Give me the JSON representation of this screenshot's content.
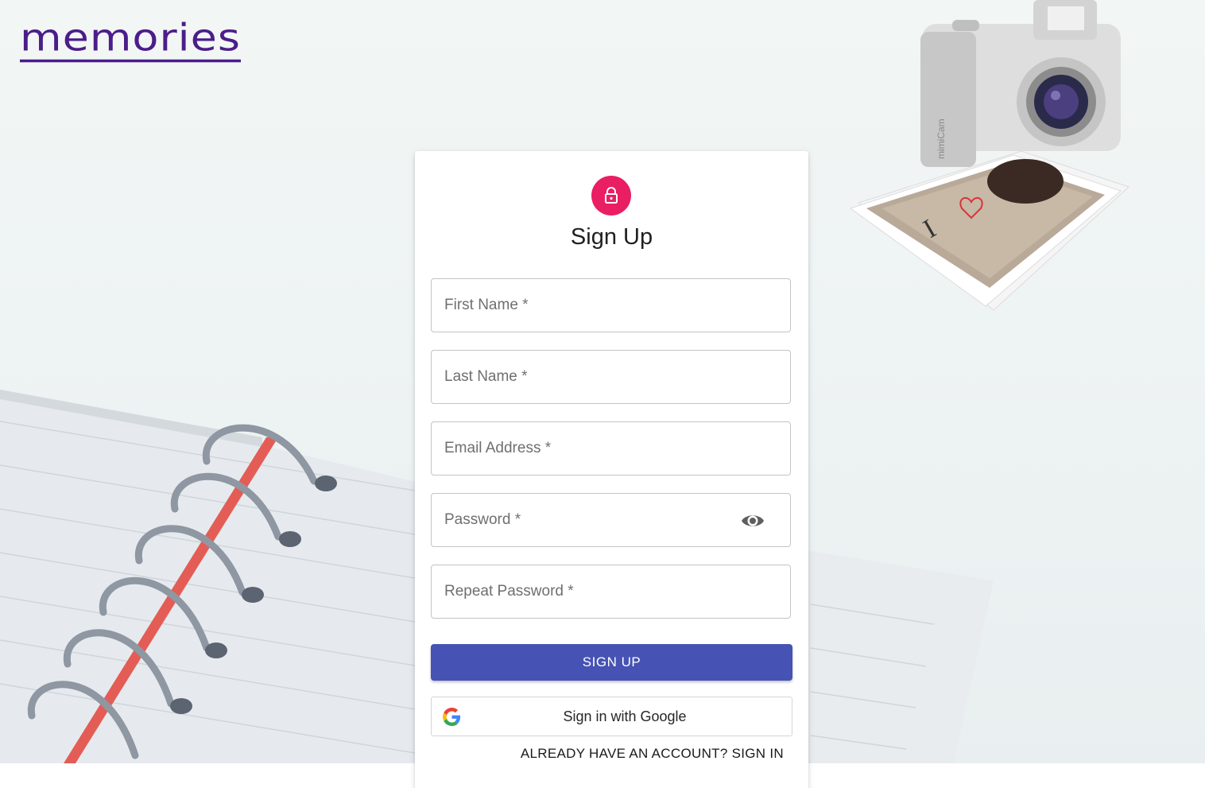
{
  "app": {
    "logo_text": "memories"
  },
  "form": {
    "title": "Sign Up",
    "lock_icon": "lock-icon",
    "fields": [
      {
        "label": "First Name *"
      },
      {
        "label": "Last Name *"
      },
      {
        "label": "Email Address *"
      },
      {
        "label": "Password *",
        "icon": "eye-icon"
      },
      {
        "label": "Repeat Password *"
      }
    ],
    "submit_label": "SIGN UP",
    "google_label": "Sign in with Google",
    "google_icon": "google-icon",
    "signin_link": "ALREADY HAVE AN ACCOUNT? SIGN IN"
  },
  "colors": {
    "brand": "#4b1d8a",
    "avatar": "#e91e63",
    "primary_button": "#4652b4"
  }
}
